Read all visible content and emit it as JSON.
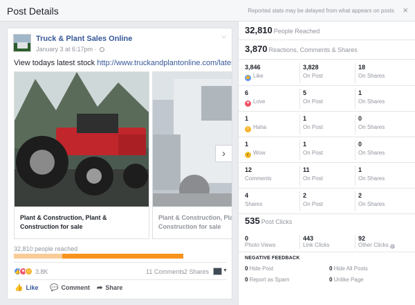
{
  "header": {
    "title": "Post Details",
    "disclaimer": "Reported stats may be delayed from what appears on posts",
    "close_icon": "×"
  },
  "post": {
    "page_name": "Truck & Plant Sales Online",
    "time": "January 3 at 6:17pm · ",
    "text_prefix": "View todays latest stock ",
    "link": "http://www.truckandplantonline.com/lateststock",
    "carousel": [
      {
        "caption": "Plant & Construction, Plant & Construction for sale"
      },
      {
        "caption": "Plant & Construction, Plant & Construction for sale"
      }
    ],
    "next_arrow": "›",
    "reach_label": "32,810 people reached",
    "reach_organic_fraction": 0.286,
    "reactions_total": "3.8K",
    "comments": "11 Comments",
    "shares": "2 Shares",
    "actions": {
      "like": "Like",
      "comment": "Comment",
      "share": "Share"
    }
  },
  "stats": {
    "people_reached": "32,810",
    "people_reached_label": "People Reached",
    "engagement": "3,870",
    "engagement_label": "Reactions, Comments & Shares",
    "grid": [
      {
        "c1v": "3,846",
        "c1l": "Like",
        "c2v": "3,828",
        "c2l": "On Post",
        "c3v": "18",
        "c3l": "On Shares",
        "emo": "like"
      },
      {
        "c1v": "6",
        "c1l": "Love",
        "c2v": "5",
        "c2l": "On Post",
        "c3v": "1",
        "c3l": "On Shares",
        "emo": "love"
      },
      {
        "c1v": "1",
        "c1l": "Haha",
        "c2v": "1",
        "c2l": "On Post",
        "c3v": "0",
        "c3l": "On Shares",
        "emo": "haha"
      },
      {
        "c1v": "1",
        "c1l": "Wow",
        "c2v": "1",
        "c2l": "On Post",
        "c3v": "0",
        "c3l": "On Shares",
        "emo": "wow"
      },
      {
        "c1v": "12",
        "c1l": "Comments",
        "c2v": "11",
        "c2l": "On Post",
        "c3v": "1",
        "c3l": "On Shares",
        "emo": ""
      },
      {
        "c1v": "4",
        "c1l": "Shares",
        "c2v": "2",
        "c2l": "On Post",
        "c3v": "2",
        "c3l": "On Shares",
        "emo": ""
      }
    ],
    "post_clicks": "535",
    "post_clicks_label": "Post Clicks",
    "photo_views": "0",
    "photo_views_label": "Photo Views",
    "link_clicks": "443",
    "link_clicks_label": "Link Clicks",
    "other_clicks": "92",
    "other_clicks_label": "Other Clicks",
    "negative_title": "NEGATIVE FEEDBACK",
    "negative": [
      {
        "v": "0",
        "l": "Hide Post"
      },
      {
        "v": "0",
        "l": "Hide All Posts"
      },
      {
        "v": "0",
        "l": "Report as Spam"
      },
      {
        "v": "0",
        "l": "Unlike Page"
      }
    ]
  },
  "colors": {
    "link": "#365899",
    "reach_paid": "#f7931e",
    "reach_organic": "#f8cc96",
    "like": "#5890ff",
    "love": "#f25268",
    "haha": "#f7b125"
  }
}
